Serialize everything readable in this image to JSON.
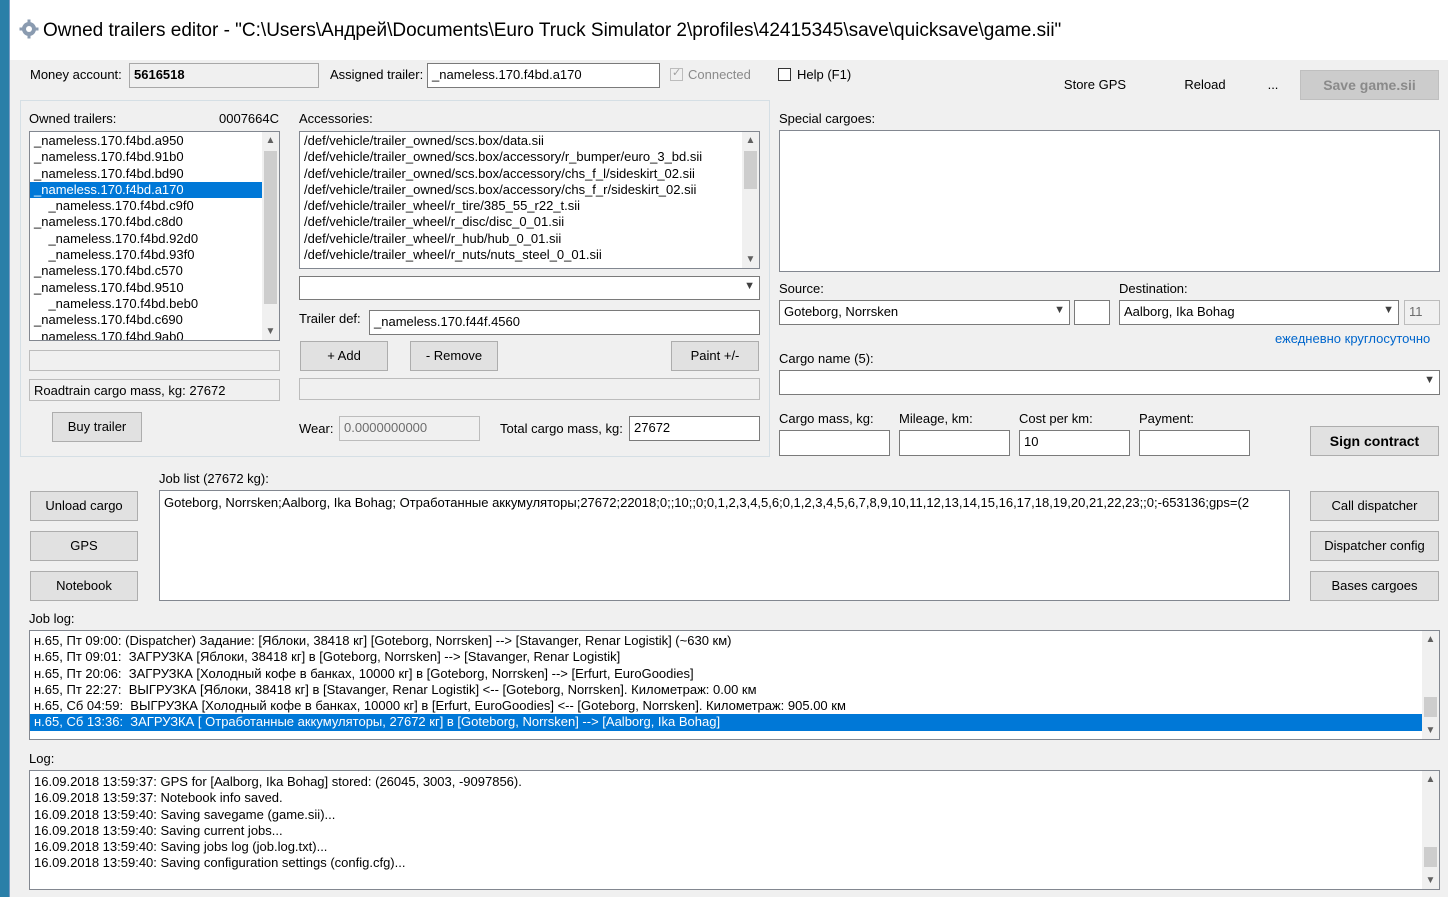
{
  "window": {
    "title": "Owned trailers editor - \"C:\\Users\\Андрей\\Documents\\Euro Truck Simulator 2\\profiles\\42415345\\save\\quicksave\\game.sii\""
  },
  "top": {
    "money_label": "Money account:",
    "money_value": "5616518",
    "assigned_label": "Assigned trailer:",
    "assigned_value": "_nameless.170.f4bd.a170",
    "connected_label": "Connected",
    "help_label": "Help (F1)",
    "store_gps": "Store GPS",
    "reload": "Reload",
    "ellipsis": "...",
    "save_game": "Save game.sii"
  },
  "owned": {
    "label": "Owned trailers:",
    "code": "0007664C",
    "items": [
      "_nameless.170.f4bd.a950",
      "_nameless.170.f4bd.91b0",
      "_nameless.170.f4bd.bd90",
      "_nameless.170.f4bd.a170",
      "    _nameless.170.f4bd.c9f0",
      "_nameless.170.f4bd.c8d0",
      "    _nameless.170.f4bd.92d0",
      "    _nameless.170.f4bd.93f0",
      "_nameless.170.f4bd.c570",
      "_nameless.170.f4bd.9510",
      "    _nameless.170.f4bd.beb0",
      "_nameless.170.f4bd.c690",
      "_nameless.170.f4bd.9ab0"
    ],
    "selected_index": 3,
    "roadtrain_label": "Roadtrain cargo mass, kg: 27672",
    "buy_trailer": "Buy trailer"
  },
  "accessories": {
    "label": "Accessories:",
    "items": [
      "/def/vehicle/trailer_owned/scs.box/data.sii",
      "/def/vehicle/trailer_owned/scs.box/accessory/r_bumper/euro_3_bd.sii",
      "/def/vehicle/trailer_owned/scs.box/accessory/chs_f_l/sideskirt_02.sii",
      "/def/vehicle/trailer_owned/scs.box/accessory/chs_f_r/sideskirt_02.sii",
      "/def/vehicle/trailer_wheel/r_tire/385_55_r22_t.sii",
      "/def/vehicle/trailer_wheel/r_disc/disc_0_01.sii",
      "/def/vehicle/trailer_wheel/r_hub/hub_0_01.sii",
      "/def/vehicle/trailer_wheel/r_nuts/nuts_steel_0_01.sii"
    ],
    "trailer_def_label": "Trailer def:",
    "trailer_def_value": "_nameless.170.f44f.4560",
    "add": "+ Add",
    "remove": "- Remove",
    "paint": "Paint +/-",
    "wear_label": "Wear:",
    "wear_value": "0.0000000000",
    "total_mass_label": "Total cargo mass, kg:",
    "total_mass_value": "27672"
  },
  "cargo": {
    "special_label": "Special cargoes:",
    "source_label": "Source:",
    "source_value": "Goteborg, Norrsken",
    "destination_label": "Destination:",
    "destination_value": "Aalborg, Ika Bohag",
    "destination_num": "11",
    "daily_link": "ежедневно круглосуточно",
    "cargo_name_label": "Cargo name (5):",
    "mass_label": "Cargo mass, kg:",
    "mileage_label": "Mileage, km:",
    "cost_label": "Cost per km:",
    "cost_value": "10",
    "payment_label": "Payment:",
    "sign_contract": "Sign contract"
  },
  "jobs": {
    "unload": "Unload cargo",
    "gps": "GPS",
    "notebook": "Notebook",
    "job_list_label": "Job list (27672 kg):",
    "job_list_value": "Goteborg, Norrsken;Aalborg, Ika Bohag; Отработанные аккумуляторы;27672;22018;0;;10;;0;0,1,2,3,4,5,6;0,1,2,3,4,5,6,7,8,9,10,11,12,13,14,15,16,17,18,19,20,21,22,23;;0;-653136;gps=(2",
    "call_dispatcher": "Call dispatcher",
    "dispatcher_config": "Dispatcher config",
    "bases_cargoes": "Bases cargoes"
  },
  "job_log": {
    "label": "Job log:",
    "items": [
      "н.65, Пт 09:00: (Dispatcher) Задание: [Яблоки, 38418 кг] [Goteborg, Norrsken] --> [Stavanger, Renar Logistik] (~630 км)",
      "н.65, Пт 09:01:  ЗАГРУЗКА [Яблоки, 38418 кг] в [Goteborg, Norrsken] --> [Stavanger, Renar Logistik]",
      "н.65, Пт 20:06:  ЗАГРУЗКА [Холодный кофе в банках, 10000 кг] в [Goteborg, Norrsken] --> [Erfurt, EuroGoodies]",
      "н.65, Пт 22:27:  ВЫГРУЗКА [Яблоки, 38418 кг] в [Stavanger, Renar Logistik] <-- [Goteborg, Norrsken]. Километраж: 0.00 км",
      "н.65, Сб 04:59:  ВЫГРУЗКА [Холодный кофе в банках, 10000 кг] в [Erfurt, EuroGoodies] <-- [Goteborg, Norrsken]. Километраж: 905.00 км",
      "н.65, Сб 13:36:  ЗАГРУЗКА [ Отработанные аккумуляторы, 27672 кг] в [Goteborg, Norrsken] --> [Aalborg, Ika Bohag]"
    ],
    "selected_index": 5
  },
  "log": {
    "label": "Log:",
    "items": [
      "16.09.2018 13:59:37: GPS for [Aalborg, Ika Bohag] stored: (26045, 3003, -9097856).",
      "16.09.2018 13:59:37: Notebook info saved.",
      "16.09.2018 13:59:40: Saving savegame (game.sii)...",
      "16.09.2018 13:59:40: Saving current jobs...",
      "16.09.2018 13:59:40: Saving jobs log (job.log.txt)...",
      "16.09.2018 13:59:40: Saving configuration settings (config.cfg)..."
    ]
  }
}
